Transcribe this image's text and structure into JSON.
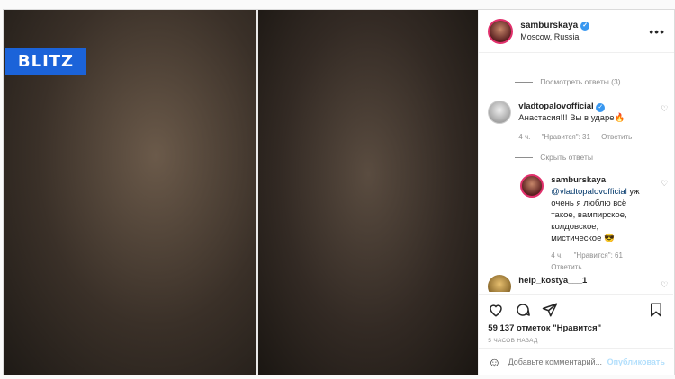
{
  "watermark": "BLITZ",
  "header": {
    "username": "samburskaya",
    "location": "Moscow, Russia",
    "more": "•••"
  },
  "comments": {
    "top_toggle": "Посмотреть ответы (3)",
    "c1": {
      "user": "vladtopalovofficial",
      "text": "Анастасия!!! Вы в ударе🔥",
      "time": "4 ч.",
      "likes": "\"Нравится\": 31",
      "reply": "Ответить"
    },
    "hide_toggle": "Скрыть ответы",
    "c2": {
      "user": "samburskaya",
      "mention": "@vladtopalovofficial",
      "text": "уж очень я люблю всё такое, вампирское, колдовское, мистическое 😎",
      "time": "4 ч.",
      "likes": "\"Нравится\": 61",
      "reply": "Ответить"
    },
    "c3": {
      "user": "help_kostya___1"
    }
  },
  "actions": {
    "likes": "59 137 отметок \"Нравится\"",
    "time": "5 ЧАСОВ НАЗАД"
  },
  "add_comment": {
    "placeholder": "Добавьте комментарий...",
    "post": "Опубликовать",
    "emoji": "☺"
  },
  "colors": {
    "link": "#00376b",
    "verified": "#3897f0",
    "logo_bg": "#1b63d9",
    "meta": "#8e8e8e"
  }
}
